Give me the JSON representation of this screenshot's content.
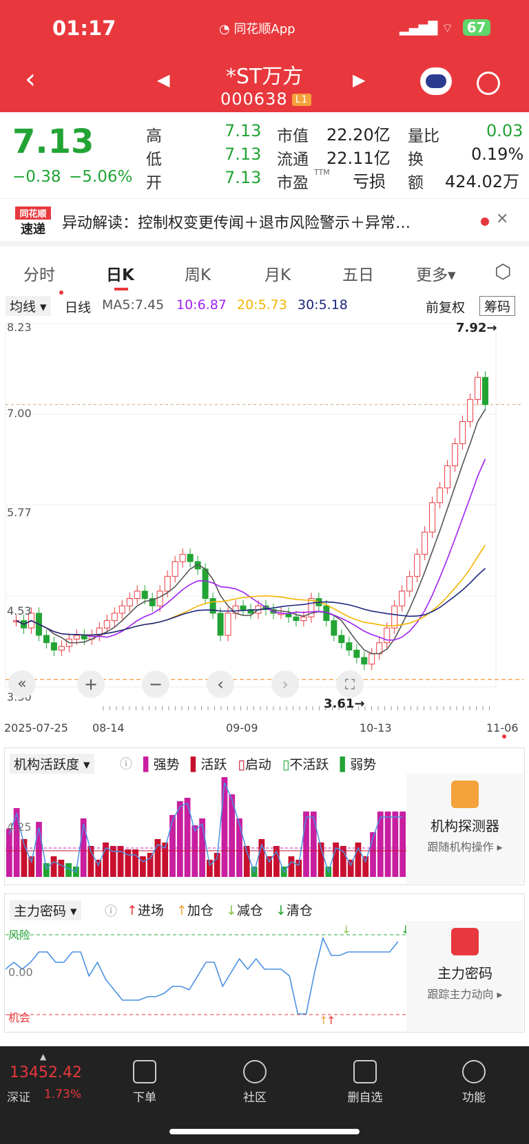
{
  "status_bar": {
    "time": "01:17",
    "app_label": "同花顺App",
    "battery": "67"
  },
  "header": {
    "title": "*ST万方",
    "code": "000638",
    "level": "L1"
  },
  "quote": {
    "price": "7.13",
    "change": "−0.38",
    "change_pct": "−5.06%",
    "high_label": "高",
    "high": "7.13",
    "low_label": "低",
    "low": "7.13",
    "open_label": "开",
    "open": "7.13",
    "mcap_label": "市值",
    "mcap": "22.20亿",
    "float_label": "流通",
    "float": "22.11亿",
    "pe_label": "市盈",
    "pe_tag": "TTM",
    "pe": "亏损",
    "vol_ratio_label": "量比",
    "vol_ratio": "0.03",
    "turnover_label": "换",
    "turnover": "0.19%",
    "amount_label": "额",
    "amount": "424.02万"
  },
  "news": {
    "brand_top": "同花顺",
    "brand_bottom": "速递",
    "text": "异动解读：控制权变更传闻＋退市风险警示＋异常…"
  },
  "tabs": [
    "分时",
    "日K",
    "周K",
    "月K",
    "五日",
    "更多▾"
  ],
  "ma_bar": {
    "selector": "均线",
    "period": "日线",
    "ma5": "MA5:7.45",
    "ma10": "10:6.87",
    "ma20": "20:5.73",
    "ma30": "30:5.18",
    "fq": "前复权",
    "chips": "筹码"
  },
  "chart_data": {
    "type": "candlestick",
    "y_ticks": [
      "8.23",
      "7.00",
      "5.77",
      "4.53",
      "3.30"
    ],
    "x_ticks": [
      "2025-07-25",
      "08-14",
      "09-09",
      "10-13",
      "11-06"
    ],
    "high_marker": "7.92→",
    "low_marker": "3.61→",
    "close": [
      4.2,
      4.1,
      4.3,
      4.0,
      3.9,
      3.8,
      3.85,
      3.95,
      4.0,
      3.95,
      4.0,
      4.1,
      4.2,
      4.3,
      4.4,
      4.5,
      4.6,
      4.5,
      4.4,
      4.6,
      4.8,
      5.0,
      5.1,
      5.0,
      4.9,
      4.5,
      4.3,
      4.0,
      4.3,
      4.4,
      4.35,
      4.3,
      4.4,
      4.35,
      4.3,
      4.3,
      4.25,
      4.2,
      4.25,
      4.5,
      4.4,
      4.2,
      4.0,
      3.9,
      3.8,
      3.7,
      3.61,
      3.75,
      3.9,
      4.1,
      4.4,
      4.6,
      4.8,
      5.1,
      5.4,
      5.8,
      6.0,
      6.3,
      6.6,
      6.9,
      7.2,
      7.5,
      7.13
    ]
  },
  "inst": {
    "selector": "机构活跃度",
    "legend": [
      "强势",
      "活跃",
      "启动",
      "不活跃",
      "弱势"
    ],
    "axis": "4.25",
    "side_title": "机构探测器",
    "side_sub": "跟随机构操作 ▸"
  },
  "main": {
    "selector": "主力密码",
    "legend": [
      "进场",
      "加仓",
      "减仓",
      "清仓"
    ],
    "risk": "风险",
    "zero": "0.00",
    "chance": "机会",
    "side_title": "主力密码",
    "side_sub": "跟踪主力动向 ▸"
  },
  "bottom": {
    "index_value": "13452.42",
    "index_name": "深证",
    "index_pct": "1.73%",
    "nav": [
      "下单",
      "社区",
      "删自选",
      "功能"
    ]
  },
  "colors": {
    "red": "#e8383d",
    "green": "#22a434",
    "ma5": "#555555",
    "ma10": "#a020f0",
    "ma20": "#f4b400",
    "ma30": "#1a237e"
  }
}
